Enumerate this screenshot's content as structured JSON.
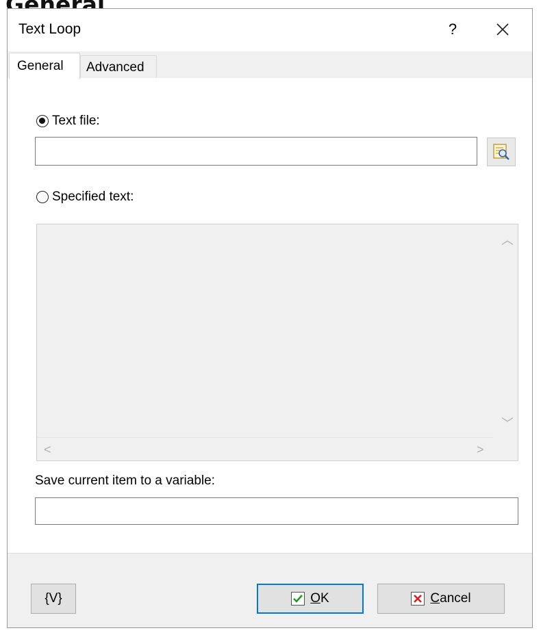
{
  "page_heading": "General",
  "window": {
    "title": "Text Loop",
    "help_label": "?",
    "close_icon": "close-icon"
  },
  "tabs": [
    {
      "label": "General",
      "active": true
    },
    {
      "label": "Advanced",
      "active": false
    }
  ],
  "source": {
    "text_file": {
      "label": "Text file:",
      "checked": true,
      "value": "",
      "browse_icon": "browse-file-icon"
    },
    "specified_text": {
      "label": "Specified text:",
      "checked": false,
      "value": ""
    }
  },
  "variable": {
    "label": "Save current item to a variable:",
    "value": ""
  },
  "buttons": {
    "variables": "{V}",
    "ok": {
      "accel": "O",
      "rest": "K",
      "icon": "checkmark-icon",
      "icon_color": "#1e9a1e"
    },
    "cancel": {
      "accel": "C",
      "rest": "ancel",
      "icon": "cross-icon",
      "icon_color": "#d42020"
    }
  },
  "colors": {
    "dialog_bg": "#f0f0f0",
    "focus_border": "#0078d7"
  }
}
